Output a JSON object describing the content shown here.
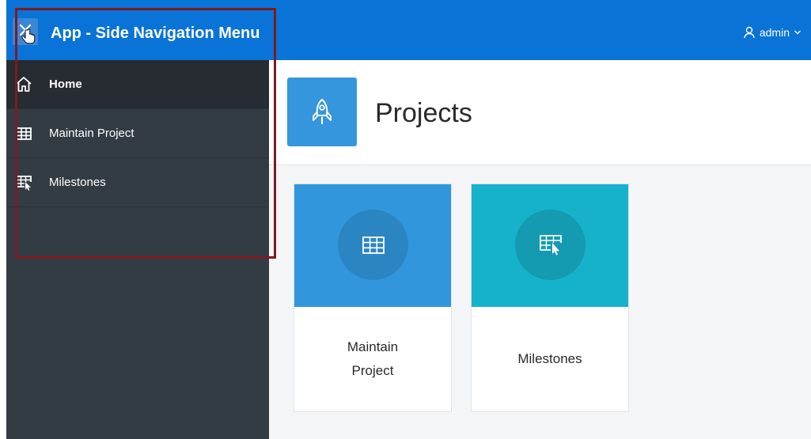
{
  "header": {
    "title": "App - Side Navigation Menu",
    "user_label": "admin",
    "toggle_icon": "close-icon",
    "user_icon": "user-icon",
    "bg_color": "#0a73d8"
  },
  "sidebar": {
    "items": [
      {
        "label": "Home",
        "icon": "home-icon",
        "active": true
      },
      {
        "label": "Maintain Project",
        "icon": "table-icon",
        "active": false
      },
      {
        "label": "Milestones",
        "icon": "table-pointer-icon",
        "active": false
      }
    ],
    "bg_color": "#333c43"
  },
  "main": {
    "page_title": "Projects",
    "page_icon": "rocket-icon",
    "cards": [
      {
        "label": "Maintain Project",
        "icon": "table-icon",
        "color": "#3196dc"
      },
      {
        "label": "Milestones",
        "icon": "table-pointer-icon",
        "color": "#16b2cb"
      }
    ]
  }
}
